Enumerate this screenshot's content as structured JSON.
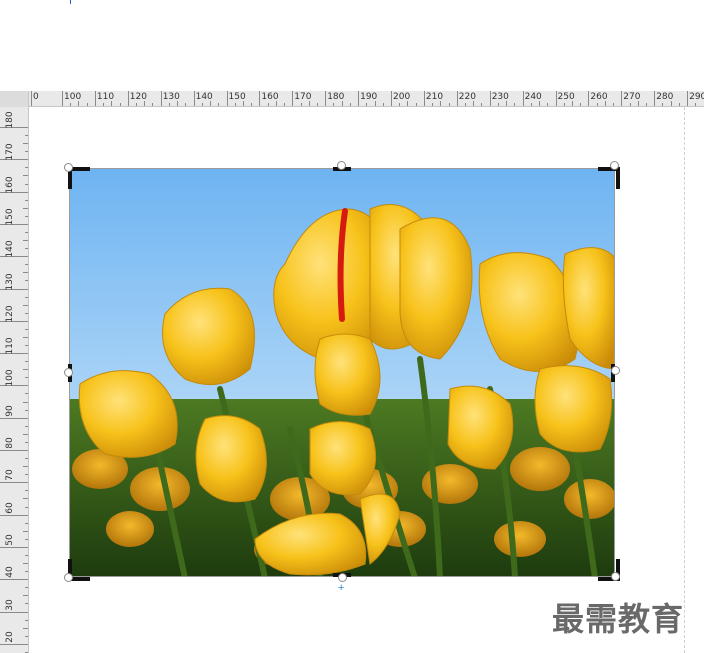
{
  "ruler": {
    "horizontal": [
      "0",
      "100",
      "110",
      "120",
      "130",
      "140",
      "150",
      "160",
      "170",
      "180",
      "190",
      "200",
      "210",
      "220",
      "230",
      "240",
      "250",
      "260",
      "270",
      "280",
      "290"
    ],
    "vertical": [
      "180",
      "170",
      "160",
      "150",
      "140",
      "130",
      "120",
      "110",
      "100",
      "90",
      "80",
      "70",
      "60",
      "50",
      "40",
      "30",
      "20"
    ]
  },
  "image": {
    "subject": "yellow tulips under blue sky"
  },
  "watermark": {
    "text": "最需教育"
  }
}
